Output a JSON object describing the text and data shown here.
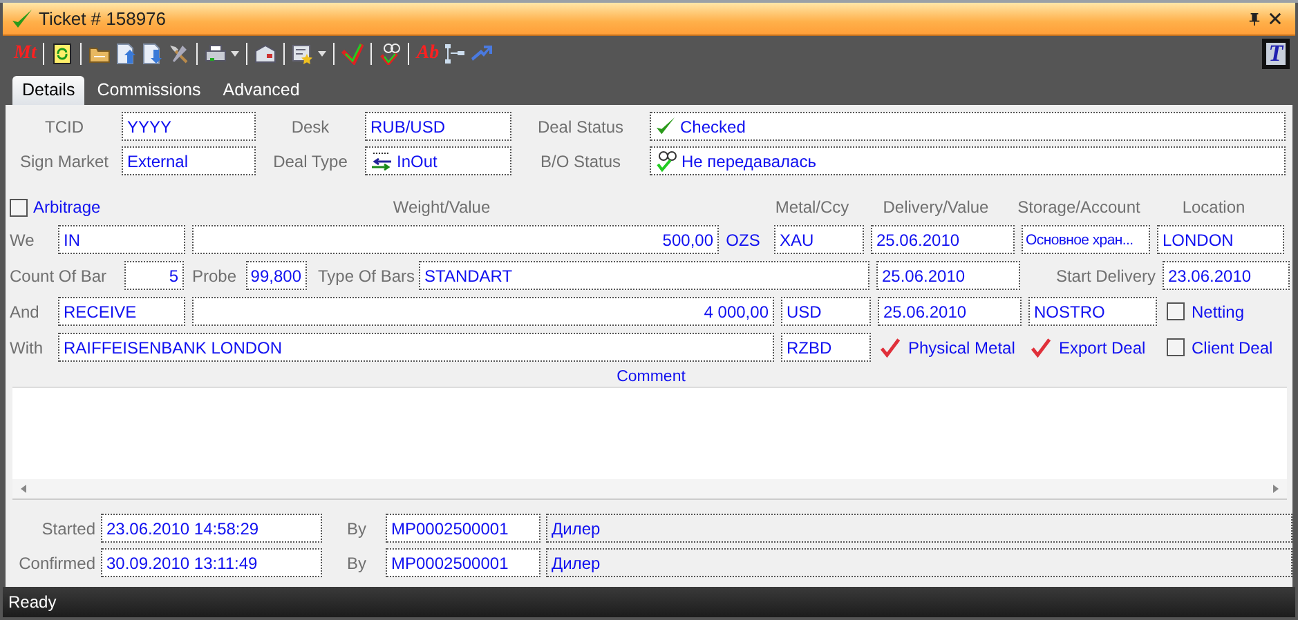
{
  "window": {
    "title": "Ticket # 158976"
  },
  "toolbar": {
    "text_icons": [
      "Mt",
      "Ab"
    ],
    "logo": "T"
  },
  "tabs": [
    {
      "label": "Details",
      "selected": true
    },
    {
      "label": "Commissions",
      "selected": false
    },
    {
      "label": "Advanced",
      "selected": false
    }
  ],
  "header_fields": [
    {
      "label": "TCID",
      "value": "YYYY",
      "kind": "plain"
    },
    {
      "label": "Desk",
      "value": "RUB/USD",
      "kind": "plain"
    },
    {
      "label": "Deal Status",
      "value": "Checked",
      "kind": "checked"
    },
    {
      "label": "Sign Market",
      "value": "External",
      "kind": "plain"
    },
    {
      "label": "Deal Type",
      "value": "InOut",
      "kind": "inout"
    },
    {
      "label": "B/O Status",
      "value": "Не передавалась",
      "kind": "bo"
    }
  ],
  "arbitrage": {
    "label": "Arbitrage",
    "checked": false
  },
  "columns": [
    "Weight/Value",
    "Metal/Ccy",
    "Delivery/Value",
    "Storage/Account",
    "Location"
  ],
  "we": {
    "label": "We",
    "side": "IN",
    "amount": "500,00",
    "unit": "OZS",
    "metal": "XAU",
    "date": "25.06.2010",
    "storage": "Основное хран...",
    "location": "LONDON"
  },
  "bars": {
    "count_label": "Count Of Bar",
    "count": "5",
    "probe_label": "Probe",
    "probe": "99,800",
    "type_label": "Type Of Bars",
    "type": "STANDART",
    "date": "25.06.2010",
    "start_label": "Start Delivery",
    "start": "23.06.2010"
  },
  "and": {
    "label": "And",
    "side": "RECEIVE",
    "amount": "4 000,00",
    "ccy": "USD",
    "date": "25.06.2010",
    "account": "NOSTRO",
    "netting": {
      "label": "Netting",
      "checked": false
    }
  },
  "with": {
    "label": "With",
    "counterparty": "RAIFFEISENBANK LONDON",
    "code": "RZBD",
    "physical_metal": {
      "label": "Physical Metal",
      "checked": true
    },
    "export_deal": {
      "label": "Export Deal",
      "checked": true
    },
    "client_deal": {
      "label": "Client Deal",
      "checked": false
    }
  },
  "comment": {
    "label": "Comment"
  },
  "audit": [
    {
      "label": "Started",
      "time": "23.06.2010 14:58:29",
      "by_label": "By",
      "user": "MP0002500001",
      "role": "Дилер"
    },
    {
      "label": "Confirmed",
      "time": "30.09.2010 13:11:49",
      "by_label": "By",
      "user": "MP0002500001",
      "role": "Дилер"
    }
  ],
  "status_bar": "Ready"
}
